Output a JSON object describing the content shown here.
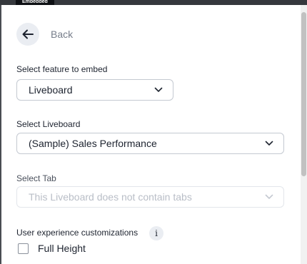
{
  "topbar": {
    "tab_label": "Embedded"
  },
  "back": {
    "label": "Back"
  },
  "feature": {
    "label": "Select feature to embed",
    "value": "Liveboard"
  },
  "liveboard": {
    "label": "Select Liveboard",
    "value": "(Sample) Sales Performance"
  },
  "tab": {
    "label": "Select Tab",
    "placeholder": "This Liveboard does not contain tabs"
  },
  "ux": {
    "label": "User experience customizations",
    "info_glyph": "i",
    "options": [
      {
        "label": "Full Height",
        "checked": false
      }
    ]
  }
}
